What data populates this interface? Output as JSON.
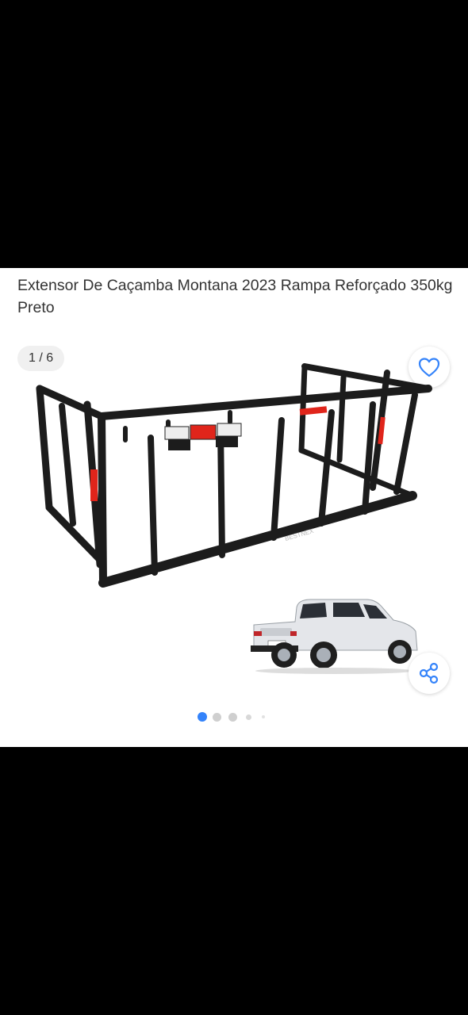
{
  "product": {
    "title": "Extensor De Caçamba Montana 2023 Rampa Reforçado 350kg Preto",
    "brand_on_rack": "BESTNEX"
  },
  "gallery": {
    "counter": "1 / 6",
    "current": 1,
    "total": 6
  },
  "icons": {
    "favorite": "heart-outline-icon",
    "share": "share-icon"
  },
  "colors": {
    "accent": "#3483fa",
    "text": "#333333",
    "rack": "#1a1a1a",
    "reflector": "#e0251b",
    "dot_inactive": "#cfcfcf"
  }
}
